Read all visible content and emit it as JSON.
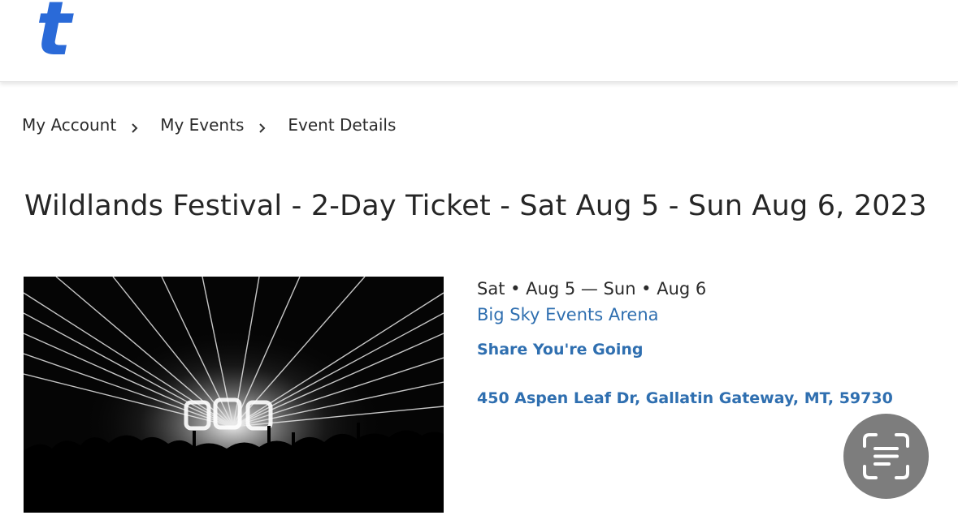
{
  "header": {
    "logo_text": "t",
    "brand_color": "#2a6ad8"
  },
  "breadcrumb": {
    "items": [
      {
        "label": "My Account"
      },
      {
        "label": "My Events"
      },
      {
        "label": "Event Details"
      }
    ],
    "separator_icon": "chevron-right-icon"
  },
  "page": {
    "title": "Wildlands Festival - 2-Day Ticket - Sat Aug 5 - Sun Aug 6, 2023"
  },
  "event": {
    "image_icon": "concert-photo",
    "dates": "Sat • Aug 5 — Sun • Aug 6",
    "venue": "Big Sky Events Arena",
    "share_label": "Share You're Going",
    "address": "450 Aspen Leaf Dr, Gallatin Gateway, MT, 59730",
    "link_color": "#2f6fb0"
  },
  "overlay": {
    "scan_icon": "text-scan-icon",
    "button_color": "#7d7d7d"
  }
}
